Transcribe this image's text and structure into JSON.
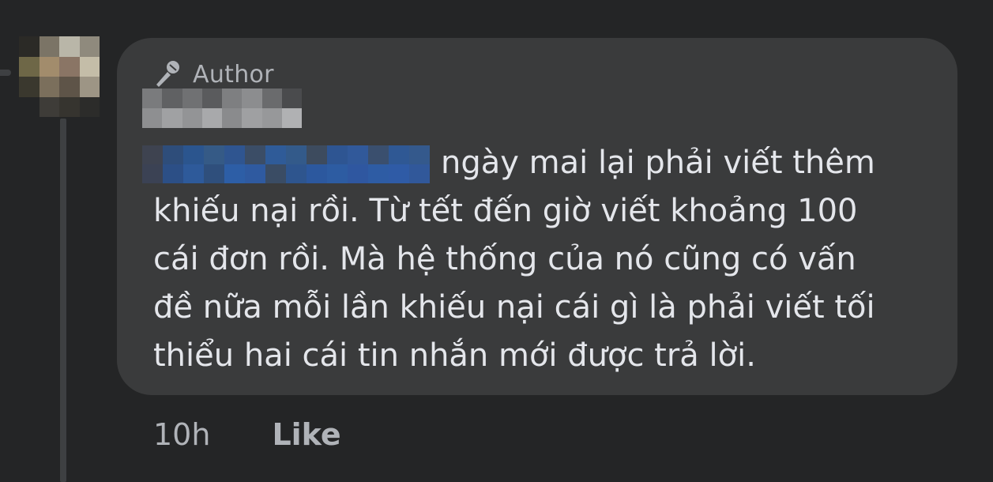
{
  "comment": {
    "badge": {
      "label": "Author",
      "icon": "microphone-icon"
    },
    "text_first_line": "ngày mai lại phải viết thêm",
    "text_rest": "khiếu nại rồi. Từ tết đến giờ viết khoảng 100\ncái đơn rồi. Mà hệ thống của nó cũng có vấn\nđề nữa mỗi lần khiếu nại cái gì là phải viết tối\nthiểu hai cái tin nhắn mới được trả lời.",
    "timestamp": "10h",
    "like_label": "Like"
  },
  "colors": {
    "background": "#242526",
    "bubble": "#3a3b3c",
    "text_primary": "#e4e6eb",
    "text_secondary": "#b0b3b8",
    "thread_line": "#3e4042"
  }
}
